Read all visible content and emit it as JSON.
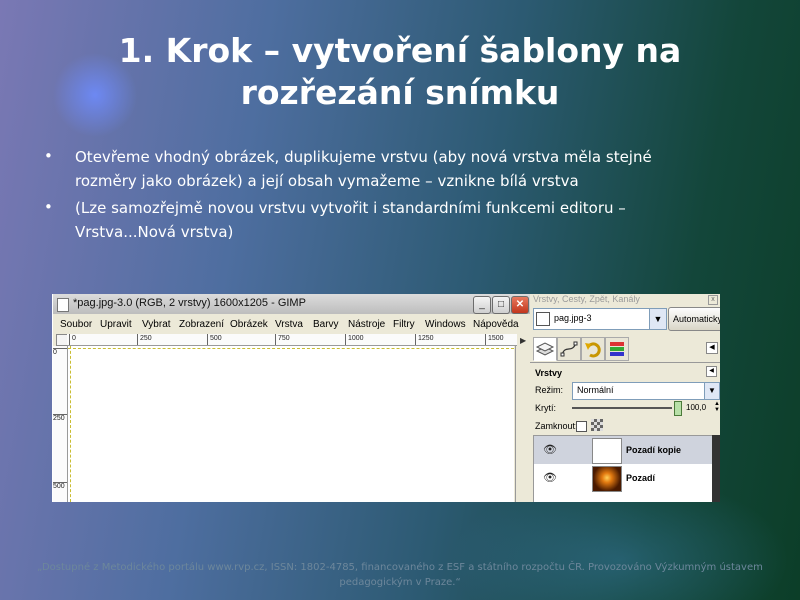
{
  "slide": {
    "title": "1. Krok – vytvoření šablony na rozřezání snímku",
    "bullet_glyph": "•",
    "bullets": [
      "Otevřeme vhodný obrázek, duplikujeme vrstvu (aby nová vrstva měla stejné rozměry jako obrázek) a její obsah vymažeme – vznikne bílá vrstva",
      "(Lze samozřejmě novou vrstvu vytvořit i standardními funkcemi editoru – Vrstva...Nová vrstva)"
    ],
    "footer": "„Dostupné z Metodického portálu www.rvp.cz, ISSN: 1802-4785, financovaného z ESF a státního rozpočtu ČR. Provozováno Výzkumným ústavem pedagogickým v Praze.“"
  },
  "gimp_window": {
    "title": "*pag.jpg-3.0 (RGB, 2 vrstvy) 1600x1205 - GIMP",
    "buttons": {
      "minimize": "_",
      "maximize": "□",
      "close": "✕"
    },
    "menu": [
      "Soubor",
      "Upravit",
      "Vybrat",
      "Zobrazení",
      "Obrázek",
      "Vrstva",
      "Barvy",
      "Nástroje",
      "Filtry",
      "Windows",
      "Nápověda"
    ],
    "ruler_h": [
      "0",
      "250",
      "500",
      "750",
      "1000",
      "1250",
      "1500"
    ],
    "ruler_v": [
      "0",
      "250",
      "500"
    ],
    "scroll_arrow": "▶"
  },
  "layers_dock": {
    "header": "Vrstvy, Cesty, Zpět, Kanály",
    "close": "x",
    "image_select": "pag.jpg-3",
    "auto_button": "Automaticky",
    "tab_icons": [
      "layers-tab-icon",
      "paths-tab-icon",
      "undo-tab-icon",
      "channels-tab-icon"
    ],
    "panel_title": "Vrstvy",
    "mode_label": "Režim:",
    "mode_value": "Normální",
    "opacity_label": "Krytí:",
    "opacity_value": "100,0",
    "opacity_level": 1.0,
    "lock_label": "Zamknout:",
    "layers": [
      {
        "name": "Pozadí kopie",
        "selected": true,
        "thumb": "white"
      },
      {
        "name": "Pozadí",
        "selected": false,
        "thumb": "photo"
      }
    ],
    "eye_glyph": "👁",
    "dropdown_arrow": "▼",
    "menu_arrow": "◀",
    "colors": {
      "selected_row": "#cfd3dd",
      "slider_handle": "#b8e0a8"
    }
  }
}
